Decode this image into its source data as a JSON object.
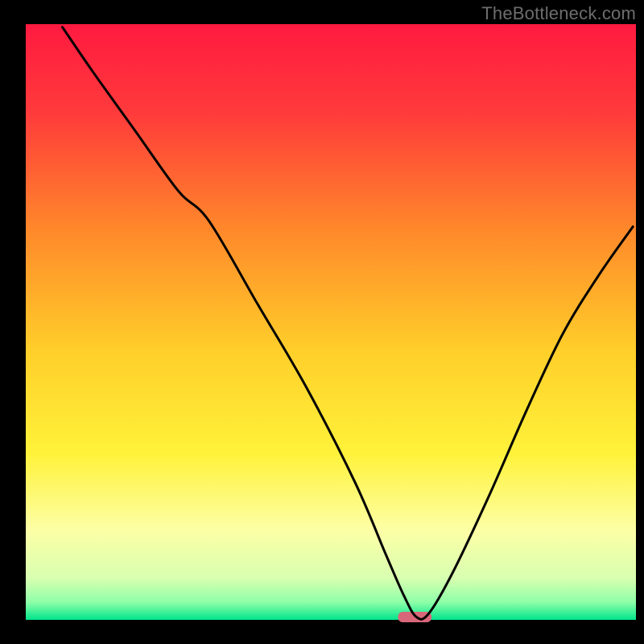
{
  "watermark": "TheBottleneck.com",
  "chart_data": {
    "type": "line",
    "title": "",
    "xlabel": "",
    "ylabel": "",
    "xlim": [
      0,
      100
    ],
    "ylim": [
      0,
      100
    ],
    "legend": false,
    "grid": false,
    "background_gradient": {
      "stops": [
        {
          "pos": 0.0,
          "color": "#ff1a40"
        },
        {
          "pos": 0.15,
          "color": "#ff3b3b"
        },
        {
          "pos": 0.35,
          "color": "#ff8a2a"
        },
        {
          "pos": 0.55,
          "color": "#ffcf2a"
        },
        {
          "pos": 0.72,
          "color": "#fff23a"
        },
        {
          "pos": 0.85,
          "color": "#fdffa6"
        },
        {
          "pos": 0.93,
          "color": "#d8ffb0"
        },
        {
          "pos": 0.97,
          "color": "#8fffa8"
        },
        {
          "pos": 1.0,
          "color": "#00e58c"
        }
      ]
    },
    "optimal_marker": {
      "x_start": 61,
      "x_end": 66.5,
      "y": 0,
      "color": "#d9677a"
    },
    "series": [
      {
        "name": "bottleneck-curve",
        "color": "#000000",
        "x": [
          6.0,
          11.0,
          18.0,
          25.0,
          30.0,
          38.0,
          46.0,
          54.0,
          59.0,
          62.0,
          64.0,
          66.0,
          70.0,
          76.0,
          82.0,
          88.0,
          94.0,
          99.5
        ],
        "y": [
          99.5,
          92.0,
          82.0,
          72.0,
          67.0,
          53.0,
          39.0,
          23.0,
          11.0,
          4.0,
          0.5,
          1.0,
          8.0,
          21.0,
          35.0,
          48.0,
          58.0,
          66.0
        ]
      }
    ]
  }
}
